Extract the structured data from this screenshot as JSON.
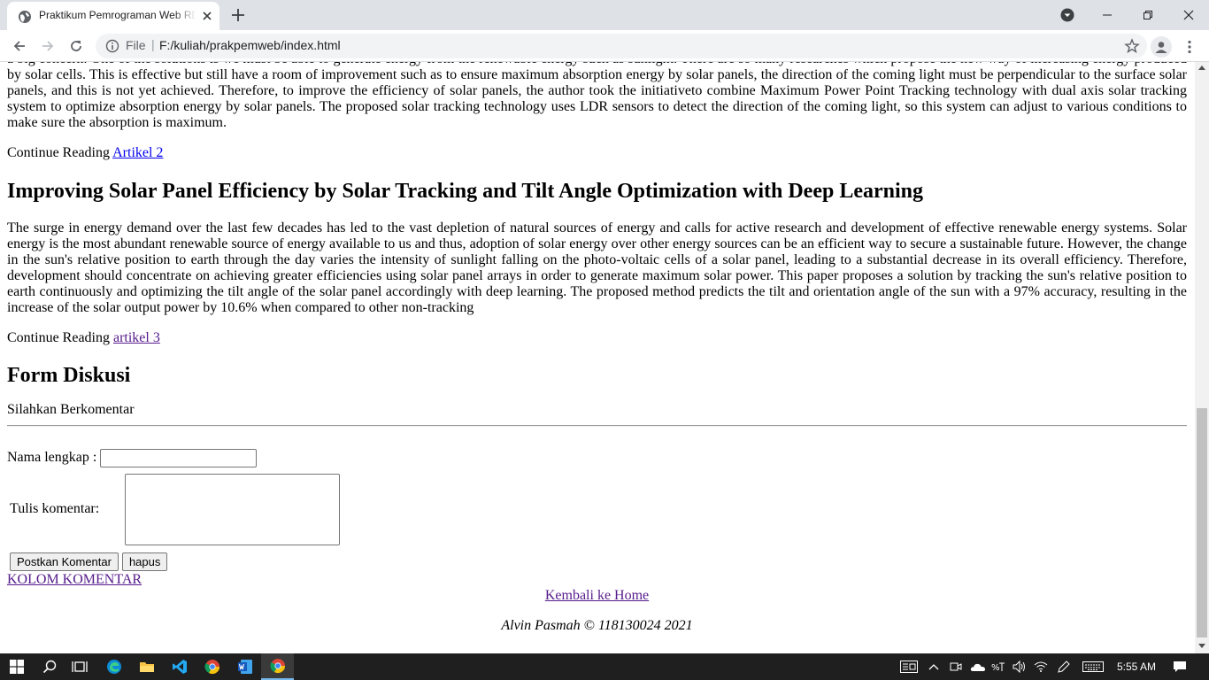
{
  "browser": {
    "tab_title": "Praktikum Pemrograman Web RD",
    "url_scheme": "File",
    "url_separator": "|",
    "url": "F:/kuliah/prakpemweb/index.html"
  },
  "page": {
    "article2": {
      "paragraph_top": "a big concern. One of the solutions is we must be able to generate energy from the renewable energy such as sunlight. There are so many researches which propose the new way of increasing energy produced by solar cells. This is effective but still have a room of improvement such as to ensure maximum absorption energy by solar panels, the direction of the coming light must be perpendicular to the surface solar panels, and this is not yet achieved. Therefore, to improve the efficiency of solar panels, the author took the initiativeto combine Maximum Power Point Tracking technology with dual axis solar tracking system to optimize absorption energy by solar panels. The proposed solar tracking technology uses LDR sensors to detect the direction of the coming light, so this system can adjust to various conditions to make sure the absorption is maximum.",
      "continue_label": "Continue Reading",
      "link_text": "Artikel 2"
    },
    "article3": {
      "title": "Improving Solar Panel Efficiency by Solar Tracking and Tilt Angle Optimization with Deep Learning",
      "paragraph": "The surge in energy demand over the last few decades has led to the vast depletion of natural sources of energy and calls for active research and development of effective renewable energy systems. Solar energy is the most abundant renewable source of energy available to us and thus, adoption of solar energy over other energy sources can be an efficient way to secure a sustainable future. However, the change in the sun's relative position to earth through the day varies the intensity of sunlight falling on the photo-voltaic cells of a solar panel, leading to a substantial decrease in its overall efficiency. Therefore, development should concentrate on achieving greater efficiencies using solar panel arrays in order to generate maximum solar power. This paper proposes a solution by tracking the sun's relative position to earth continuously and optimizing the tilt angle of the solar panel accordingly with deep learning. The proposed method predicts the tilt and orientation angle of the sun with a 97% accuracy, resulting in the increase of the solar output power by 10.6% when compared to other non-tracking",
      "continue_label": "Continue Reading",
      "link_text": "artikel 3"
    },
    "form": {
      "title": "Form Diskusi",
      "subtitle": "Silahkan Berkomentar",
      "name_label": "Nama lengkap :",
      "name_value": "",
      "comment_label": "Tulis komentar:",
      "comment_value": "",
      "submit_label": "Postkan Komentar",
      "reset_label": "hapus",
      "comments_link": "KOLOM KOMENTAR"
    },
    "footer": {
      "home_link": "Kembali ke Home",
      "credit": "Alvin Pasmah © 118130024 2021"
    }
  },
  "taskbar": {
    "time": "5:55 AM"
  }
}
